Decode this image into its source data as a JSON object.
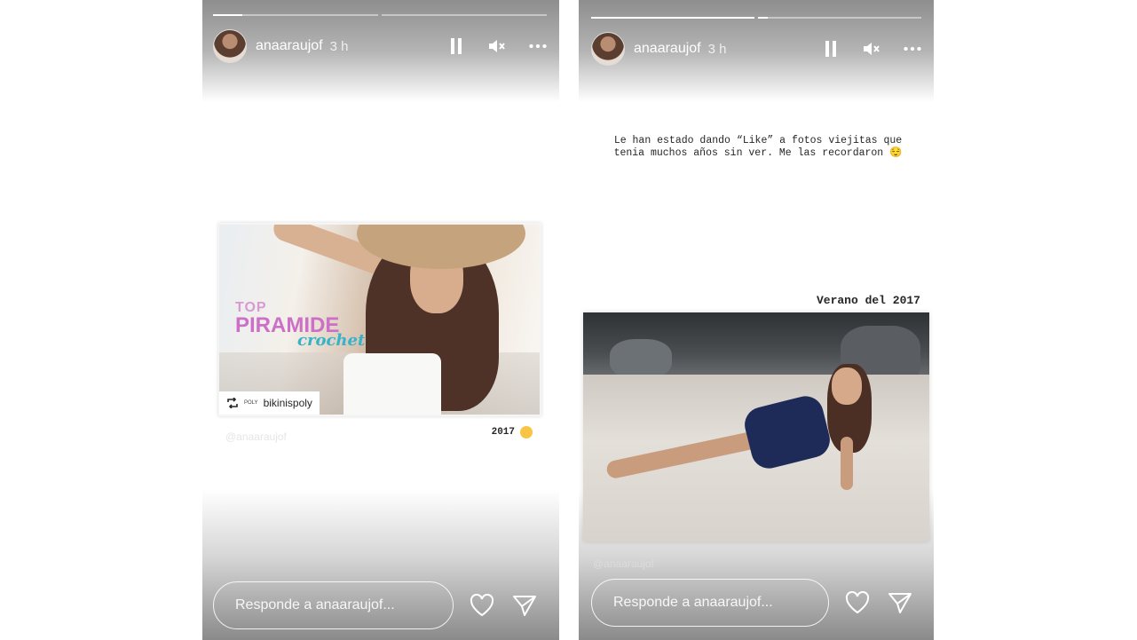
{
  "stories": [
    {
      "username": "anaaraujof",
      "time": "3 h",
      "progress": [
        0.18,
        0
      ],
      "credit_small": "POLY",
      "credit_name": "bikinispoly",
      "brand_top": "TOP",
      "brand_main": "PIRAMIDE",
      "brand_sub": "crochet",
      "caption_year": "2017",
      "watermark": "@anaaraujof",
      "reply_placeholder": "Responde a anaaraujof..."
    },
    {
      "username": "anaaraujof",
      "time": "3 h",
      "progress": [
        1,
        0.06
      ],
      "text": "Le han estado dando “Like” a fotos viejitas que tenia muchos años sin ver. Me las recordaron 😌",
      "caption": "Verano del 2017",
      "watermark": "@anaaraujof",
      "reply_placeholder": "Responde a anaaraujof..."
    }
  ],
  "icons": [
    "pause-icon",
    "mute-icon",
    "more-icon",
    "heart-icon",
    "send-icon",
    "repost-icon",
    "smile-emoji-icon"
  ],
  "colors": {
    "brand_pink": "#cc6fc6",
    "brand_teal": "#36b2c9",
    "emoji_yellow": "#f8c443"
  }
}
